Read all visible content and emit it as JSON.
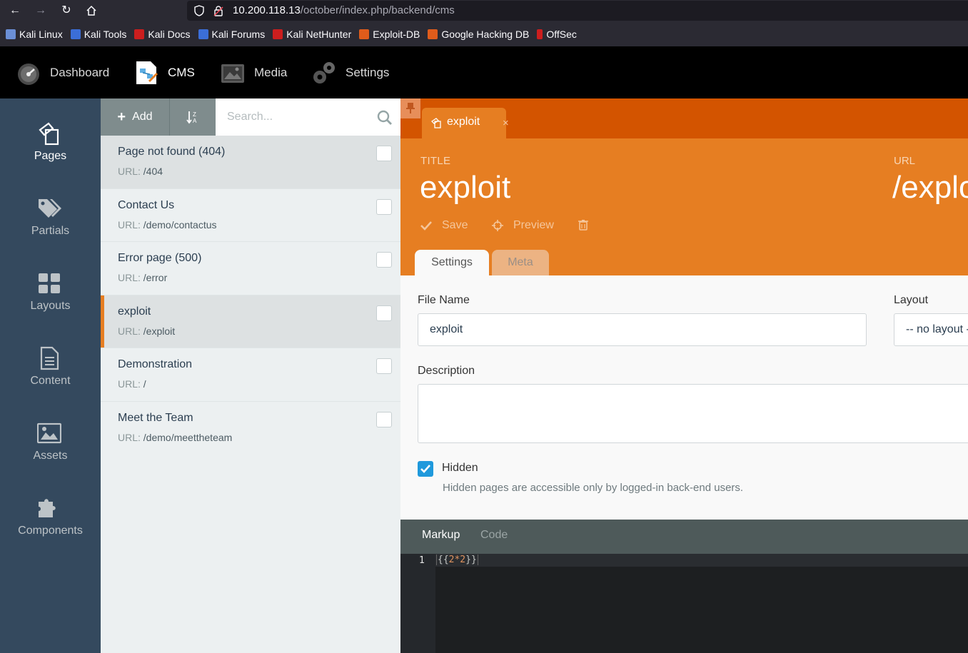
{
  "browser": {
    "url_host": "10.200.118.13",
    "url_path": "/october/index.php/backend/cms",
    "bookmarks": [
      {
        "label": "Kali Linux",
        "color": "#6b8fd6"
      },
      {
        "label": "Kali Tools",
        "color": "#3b6ed8"
      },
      {
        "label": "Kali Docs",
        "color": "#cc1e1e"
      },
      {
        "label": "Kali Forums",
        "color": "#3b6ed8"
      },
      {
        "label": "Kali NetHunter",
        "color": "#cc1e1e"
      },
      {
        "label": "Exploit-DB",
        "color": "#e05c1b"
      },
      {
        "label": "Google Hacking DB",
        "color": "#e05c1b"
      },
      {
        "label": "OffSec",
        "color": "#cc1e1e"
      }
    ]
  },
  "topnav": {
    "dashboard": "Dashboard",
    "cms": "CMS",
    "media": "Media",
    "settings": "Settings"
  },
  "sidenav": {
    "pages": "Pages",
    "partials": "Partials",
    "layouts": "Layouts",
    "content": "Content",
    "assets": "Assets",
    "components": "Components"
  },
  "list": {
    "add_label": "Add",
    "search_placeholder": "Search...",
    "url_prefix": "URL: ",
    "pages": [
      {
        "title": "Page not found (404)",
        "url": "/404"
      },
      {
        "title": "Contact Us",
        "url": "/demo/contactus"
      },
      {
        "title": "Error page (500)",
        "url": "/error"
      },
      {
        "title": "exploit",
        "url": "/exploit"
      },
      {
        "title": "Demonstration",
        "url": "/"
      },
      {
        "title": "Meet the Team",
        "url": "/demo/meettheteam"
      }
    ]
  },
  "editor": {
    "tab_label": "exploit",
    "tab_close": "×",
    "title_label": "TITLE",
    "title_value": "exploit",
    "url_label": "URL",
    "url_value": "/exploit",
    "save_label": "Save",
    "preview_label": "Preview",
    "settings_tab": "Settings",
    "meta_tab": "Meta",
    "file_name_label": "File Name",
    "file_name_value": "exploit",
    "layout_label": "Layout",
    "layout_value": "-- no layout --",
    "description_label": "Description",
    "hidden_label": "Hidden",
    "hidden_help": "Hidden pages are accessible only by logged-in back-end users.",
    "markup_tab": "Markup",
    "code_tab": "Code",
    "line_number": "1",
    "code_open": "{{",
    "code_expr": "2*2",
    "code_close": "}}"
  },
  "colors": {
    "accent_orange": "#e67e22",
    "tab_bar_orange": "#d35400",
    "sidebar_blue": "#34495e",
    "checkbox_blue": "#1f99dc"
  }
}
